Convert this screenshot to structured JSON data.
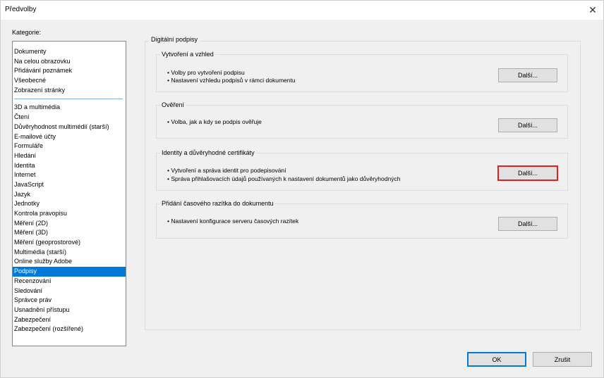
{
  "window": {
    "title": "Předvolby"
  },
  "sidebar": {
    "label": "Kategorie:",
    "group1": [
      "Dokumenty",
      "Na celou obrazovku",
      "Přidávání poznámek",
      "Všeobecné",
      "Zobrazení stránky"
    ],
    "group2": [
      "3D a multimédia",
      "Čtení",
      "Důvěryhodnost multimédií (starší)",
      "E-mailové účty",
      "Formuláře",
      "Hledání",
      "Identita",
      "Internet",
      "JavaScript",
      "Jazyk",
      "Jednotky",
      "Kontrola pravopisu",
      "Měření (2D)",
      "Měření (3D)",
      "Měření (geoprostorové)",
      "Multimédia (starší)",
      "Online služby Adobe",
      "Podpisy",
      "Recenzování",
      "Sledování",
      "Správce práv",
      "Usnadnění přístupu",
      "Zabezpečení",
      "Zabezpečení (rozšířené)"
    ],
    "selected": "Podpisy",
    "selected_color": "#0078d7"
  },
  "main": {
    "title": "Digitální podpisy",
    "sections": [
      {
        "title": "Vytvoření a vzhled",
        "bullets": [
          "• Volby pro vytvoření podpisu",
          "• Nastavení vzhledu podpisů v rámci dokumentu"
        ],
        "button": "Další..."
      },
      {
        "title": "Ověření",
        "bullets": [
          "• Volba, jak a kdy se podpis ověřuje"
        ],
        "button": "Další..."
      },
      {
        "title": "Identity a důvěryhodné certifikáty",
        "bullets": [
          "• Vytvoření a správa identit pro podepisování",
          "• Správa přihlašovacích údajů používaných k nastavení dokumentů jako důvěryhodných"
        ],
        "button": "Další..."
      },
      {
        "title": "Přidání časového razítka do dokumentu",
        "bullets": [
          "• Nastavení konfigurace serveru časových razítek"
        ],
        "button": "Další..."
      }
    ],
    "highlight_color": "#e0201c"
  },
  "footer": {
    "ok": "OK",
    "cancel": "Zrušit"
  }
}
